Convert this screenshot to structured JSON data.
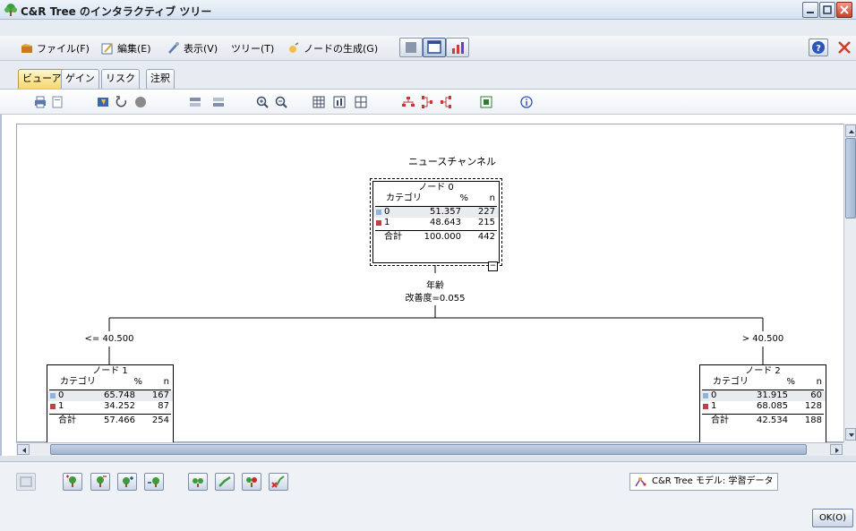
{
  "window": {
    "title": "C&R Tree のインタラクティブ ツリー",
    "icon": "tree-icon"
  },
  "menu": {
    "items": [
      {
        "label": "ファイル(F)",
        "icon": "file-icon"
      },
      {
        "label": "編集(E)",
        "icon": "edit-icon"
      },
      {
        "label": "表示(V)",
        "icon": "view-icon"
      },
      {
        "label": "ツリー(T)",
        "icon": ""
      },
      {
        "label": "ノードの生成(G)",
        "icon": "generate-icon"
      }
    ]
  },
  "tabs": [
    {
      "label": "ビューア",
      "active": true
    },
    {
      "label": "ゲイン",
      "active": false
    },
    {
      "label": "リスク",
      "active": false
    },
    {
      "label": "注釈",
      "active": false
    }
  ],
  "tree": {
    "title": "ニュースチャンネル",
    "header": {
      "col_category": "カテゴリ",
      "col_pct": "%",
      "col_n": "n"
    },
    "total_label": "合計",
    "colors": {
      "cat0": "#8fb3dc",
      "cat1": "#c0404a"
    },
    "nodes": [
      {
        "id": "ノード 0",
        "rows": [
          {
            "cat": "0",
            "pct": "51.357",
            "n": "227"
          },
          {
            "cat": "1",
            "pct": "48.643",
            "n": "215"
          }
        ],
        "total_pct": "100.000",
        "total_n": "442"
      },
      {
        "id": "ノード 1",
        "rows": [
          {
            "cat": "0",
            "pct": "65.748",
            "n": "167"
          },
          {
            "cat": "1",
            "pct": "34.252",
            "n": "87"
          }
        ],
        "total_pct": "57.466",
        "total_n": "254"
      },
      {
        "id": "ノード 2",
        "rows": [
          {
            "cat": "0",
            "pct": "31.915",
            "n": "60"
          },
          {
            "cat": "1",
            "pct": "68.085",
            "n": "128"
          }
        ],
        "total_pct": "42.534",
        "total_n": "188"
      }
    ],
    "split": {
      "variable": "年齢",
      "improvement": "改善度=0.055",
      "left_condition": "<= 40.500",
      "right_condition": "> 40.500"
    },
    "collapse_symbol": "−"
  },
  "status": {
    "model_label": "C&R Tree モデル: 学習データ"
  },
  "footer": {
    "ok_label": "OK(O)"
  }
}
